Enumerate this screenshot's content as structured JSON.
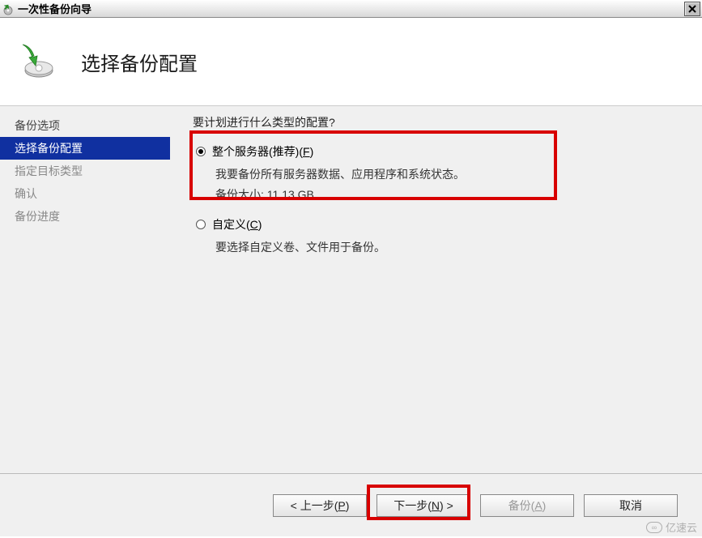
{
  "window": {
    "title": "一次性备份向导"
  },
  "header": {
    "heading": "选择备份配置"
  },
  "sidebar": {
    "items": [
      {
        "label": "备份选项",
        "state": "past"
      },
      {
        "label": "选择备份配置",
        "state": "active"
      },
      {
        "label": "指定目标类型",
        "state": "future"
      },
      {
        "label": "确认",
        "state": "future"
      },
      {
        "label": "备份进度",
        "state": "future"
      }
    ]
  },
  "content": {
    "prompt": "要计划进行什么类型的配置?",
    "options": [
      {
        "label": "整个服务器(推荐)(F)",
        "desc1": "我要备份所有服务器数据、应用程序和系统状态。",
        "desc2": "备份大小: 11.13 GB",
        "selected": true
      },
      {
        "label": "自定义(C)",
        "desc1": "要选择自定义卷、文件用于备份。",
        "desc2": "",
        "selected": false
      }
    ]
  },
  "buttons": {
    "prev": "< 上一步(P)",
    "next": "下一步(N) >",
    "backup": "备份(A)",
    "cancel": "取消"
  },
  "watermark": {
    "text": "亿速云"
  }
}
